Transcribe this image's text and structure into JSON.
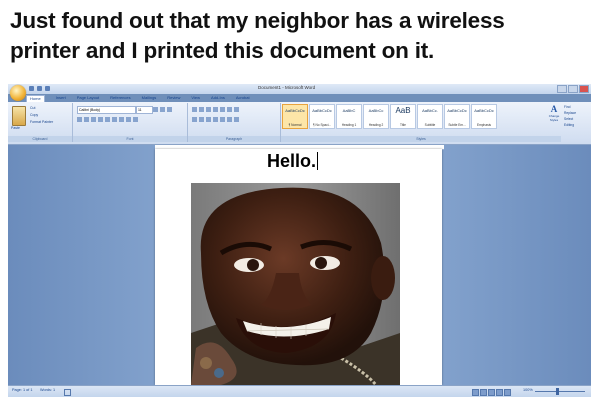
{
  "caption": {
    "line1": "Just found out that my neighbor has a wireless",
    "line2": "printer and I printed this document on it."
  },
  "window": {
    "title": "Document1 - Microsoft Word"
  },
  "ribbon_tabs": [
    "Home",
    "Insert",
    "Page Layout",
    "References",
    "Mailings",
    "Review",
    "View",
    "Add-Ins",
    "Acrobat"
  ],
  "clipboard": {
    "paste_label": "Paste",
    "cut_label": "Cut",
    "copy_label": "Copy",
    "format_painter_label": "Format Painter",
    "group_label": "Clipboard"
  },
  "font": {
    "name": "Calibri (Body)",
    "size": "11",
    "group_label": "Font"
  },
  "paragraph": {
    "group_label": "Paragraph"
  },
  "styles": {
    "items": [
      {
        "sample": "AaBbCcDc",
        "name": "¶ Normal"
      },
      {
        "sample": "AaBbCcDc",
        "name": "¶ No Spaci..."
      },
      {
        "sample": "AaBbC",
        "name": "Heading 1"
      },
      {
        "sample": "AaBbCc",
        "name": "Heading 2"
      },
      {
        "sample": "AaB",
        "name": "Title"
      },
      {
        "sample": "AaBbCc.",
        "name": "Subtitle"
      },
      {
        "sample": "AaBbCcDc",
        "name": "Subtle Em..."
      },
      {
        "sample": "AaBbCcDc",
        "name": "Emphasis"
      }
    ],
    "change_styles_label": "Change Styles",
    "group_label": "Styles"
  },
  "editing": {
    "find_label": "Find",
    "replace_label": "Replace",
    "select_label": "Select",
    "group_label": "Editing"
  },
  "document": {
    "text": "Hello."
  },
  "status": {
    "page": "Page: 1 of 1",
    "words": "Words: 1",
    "zoom": "100%"
  },
  "colors": {
    "ribbon_blue": "#15428b",
    "canvas_blue": "#86a5cf"
  }
}
